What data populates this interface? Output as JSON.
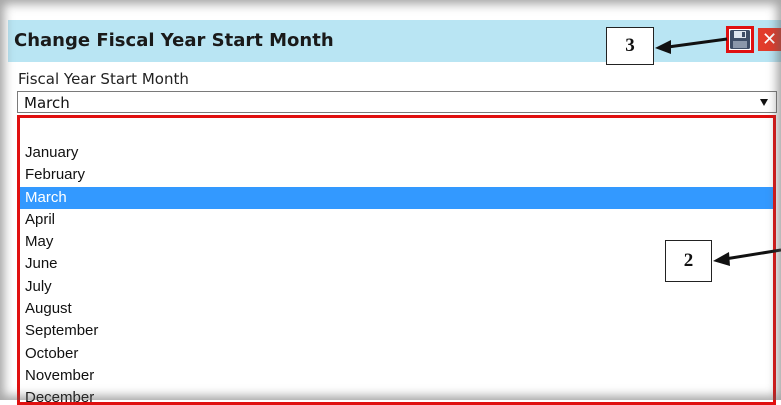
{
  "dialog": {
    "title": "Change Fiscal Year Start Month",
    "close_label": "✕"
  },
  "field": {
    "label": "Fiscal Year Start Month",
    "selected_value": "March"
  },
  "dropdown": {
    "options": [
      {
        "label": "January"
      },
      {
        "label": "February"
      },
      {
        "label": "March"
      },
      {
        "label": "April"
      },
      {
        "label": "May"
      },
      {
        "label": "June"
      },
      {
        "label": "July"
      },
      {
        "label": "August"
      },
      {
        "label": "September"
      },
      {
        "label": "October"
      },
      {
        "label": "November"
      },
      {
        "label": "December"
      }
    ],
    "highlighted_option": "March"
  },
  "callouts": {
    "save": "3",
    "list": "2"
  },
  "colors": {
    "title_bar": "#b9e5f3",
    "highlight_red": "#e01010",
    "selection_blue": "#3399ff",
    "close_red": "#e23b2b"
  }
}
